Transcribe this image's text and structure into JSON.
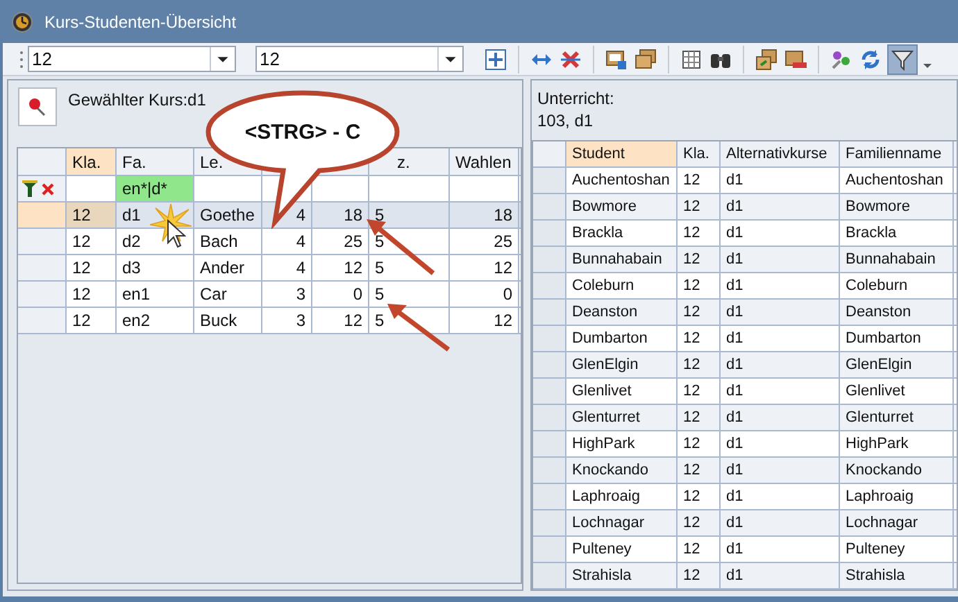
{
  "window": {
    "title": "Kurs-Studenten-Übersicht"
  },
  "toolbar": {
    "combos": [
      {
        "value": "12"
      },
      {
        "value": "12"
      }
    ],
    "filter_on": true
  },
  "left": {
    "caption": "Gewählter Kurs:d1",
    "columns": [
      {
        "label": "Kla.",
        "selected": true
      },
      {
        "label": "Fa.",
        "selected": false,
        "filter": "en*|d*"
      },
      {
        "label": "Le.",
        "selected": false
      },
      {},
      {},
      {
        "label": "z.",
        "selected": false
      },
      {
        "label": "Wahlen",
        "selected": false
      }
    ],
    "rows": [
      {
        "selected": true,
        "cells": [
          "12",
          "d1",
          "Goethe",
          "4",
          "18",
          "5",
          "18"
        ]
      },
      {
        "selected": false,
        "cells": [
          "12",
          "d2",
          "Bach",
          "4",
          "25",
          "5",
          "25"
        ]
      },
      {
        "selected": false,
        "cells": [
          "12",
          "d3",
          "Ander",
          "4",
          "12",
          "5",
          "12"
        ]
      },
      {
        "selected": false,
        "cells": [
          "12",
          "en1",
          "Car",
          "3",
          "0",
          "5",
          "0"
        ]
      },
      {
        "selected": false,
        "cells": [
          "12",
          "en2",
          "Buck",
          "3",
          "12",
          "5",
          "12"
        ]
      }
    ]
  },
  "callout": {
    "text": "<STRG> - C"
  },
  "right": {
    "heading": "Unterricht:",
    "subheading": "103, d1",
    "columns": [
      {
        "label": "Student",
        "selected": true
      },
      {
        "label": "Kla.",
        "selected": false
      },
      {
        "label": "Alternativkurse",
        "selected": false
      },
      {
        "label": "Familienname",
        "selected": false
      }
    ],
    "rows": [
      [
        "Auchentoshan",
        "12",
        "d1",
        "Auchentoshan"
      ],
      [
        "Bowmore",
        "12",
        "d1",
        "Bowmore"
      ],
      [
        "Brackla",
        "12",
        "d1",
        "Brackla"
      ],
      [
        "Bunnahabain",
        "12",
        "d1",
        "Bunnahabain"
      ],
      [
        "Coleburn",
        "12",
        "d1",
        "Coleburn"
      ],
      [
        "Deanston",
        "12",
        "d1",
        "Deanston"
      ],
      [
        "Dumbarton",
        "12",
        "d1",
        "Dumbarton"
      ],
      [
        "GlenElgin",
        "12",
        "d1",
        "GlenElgin"
      ],
      [
        "Glenlivet",
        "12",
        "d1",
        "Glenlivet"
      ],
      [
        "Glenturret",
        "12",
        "d1",
        "Glenturret"
      ],
      [
        "HighPark",
        "12",
        "d1",
        "HighPark"
      ],
      [
        "Knockando",
        "12",
        "d1",
        "Knockando"
      ],
      [
        "Laphroaig",
        "12",
        "d1",
        "Laphroaig"
      ],
      [
        "Lochnagar",
        "12",
        "d1",
        "Lochnagar"
      ],
      [
        "Pulteney",
        "12",
        "d1",
        "Pulteney"
      ],
      [
        "Strahisla",
        "12",
        "d1",
        "Strahisla"
      ]
    ]
  }
}
